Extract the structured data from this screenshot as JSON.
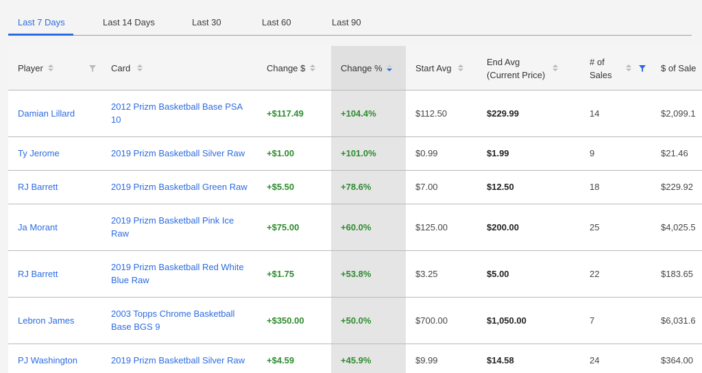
{
  "tabs": [
    {
      "label": "Last 7 Days",
      "active": true
    },
    {
      "label": "Last 14 Days",
      "active": false
    },
    {
      "label": "Last 30",
      "active": false
    },
    {
      "label": "Last 60",
      "active": false
    },
    {
      "label": "Last 90",
      "active": false
    }
  ],
  "colors": {
    "accent": "#2b6be0",
    "positive": "#2e8b2e",
    "sorted_column_bg": "#e5e5e5"
  },
  "table": {
    "headers": {
      "player": "Player",
      "card": "Card",
      "change_dollar": "Change $",
      "change_pct": "Change %",
      "start_avg": "Start Avg",
      "end_avg_line1": "End Avg",
      "end_avg_line2": "(Current Price)",
      "sales_line1": "# of",
      "sales_line2": "Sales",
      "dollar_sales": "$ of Sale"
    },
    "sorted_column": "Change %",
    "sort_direction": "descending",
    "rows": [
      {
        "player": "Damian Lillard",
        "card_l1": "2012 Prizm Basketball Base PSA",
        "card_l2": "10",
        "change_dollar": "+$117.49",
        "change_pct": "+104.4%",
        "start_avg": "$112.50",
        "end_avg": "$229.99",
        "sales": "14",
        "dollar_sales": "$2,099.1"
      },
      {
        "player": "Ty Jerome",
        "card_l1": "2019 Prizm Basketball Silver Raw",
        "card_l2": "",
        "change_dollar": "+$1.00",
        "change_pct": "+101.0%",
        "start_avg": "$0.99",
        "end_avg": "$1.99",
        "sales": "9",
        "dollar_sales": "$21.46"
      },
      {
        "player": "RJ Barrett",
        "card_l1": "2019 Prizm Basketball Green Raw",
        "card_l2": "",
        "change_dollar": "+$5.50",
        "change_pct": "+78.6%",
        "start_avg": "$7.00",
        "end_avg": "$12.50",
        "sales": "18",
        "dollar_sales": "$229.92"
      },
      {
        "player": "Ja Morant",
        "card_l1": "2019 Prizm Basketball Pink Ice",
        "card_l2": "Raw",
        "change_dollar": "+$75.00",
        "change_pct": "+60.0%",
        "start_avg": "$125.00",
        "end_avg": "$200.00",
        "sales": "25",
        "dollar_sales": "$4,025.5"
      },
      {
        "player": "RJ Barrett",
        "card_l1": "2019 Prizm Basketball Red White",
        "card_l2": "Blue Raw",
        "change_dollar": "+$1.75",
        "change_pct": "+53.8%",
        "start_avg": "$3.25",
        "end_avg": "$5.00",
        "sales": "22",
        "dollar_sales": "$183.65"
      },
      {
        "player": "Lebron James",
        "card_l1": "2003 Topps Chrome Basketball",
        "card_l2": "Base BGS 9",
        "change_dollar": "+$350.00",
        "change_pct": "+50.0%",
        "start_avg": "$700.00",
        "end_avg": "$1,050.00",
        "sales": "7",
        "dollar_sales": "$6,031.6"
      },
      {
        "player": "PJ Washington",
        "card_l1": "2019 Prizm Basketball Silver Raw",
        "card_l2": "",
        "change_dollar": "+$4.59",
        "change_pct": "+45.9%",
        "start_avg": "$9.99",
        "end_avg": "$14.58",
        "sales": "24",
        "dollar_sales": "$364.00"
      }
    ]
  }
}
